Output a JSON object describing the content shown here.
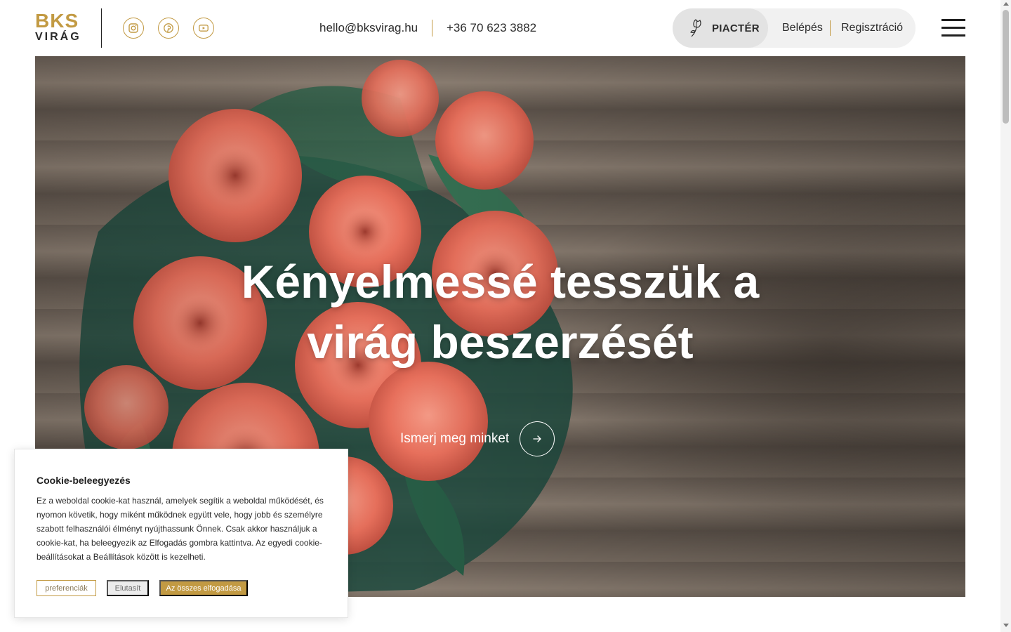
{
  "brand": {
    "line1": "BKS",
    "line2": "VIRÁG",
    "accent_color": "#c29a43",
    "text_color": "#2b2b2b"
  },
  "social": [
    {
      "name": "instagram",
      "icon": "instagram-icon"
    },
    {
      "name": "pinterest",
      "icon": "pinterest-icon"
    },
    {
      "name": "youtube",
      "icon": "youtube-icon"
    }
  ],
  "contact": {
    "email": "hello@bksvirag.hu",
    "phone": "+36 70 623 3882"
  },
  "auth": {
    "market_label": "PIACTÉR",
    "market_icon": "flower-icon",
    "login_label": "Belépés",
    "register_label": "Regisztráció"
  },
  "menu": {
    "icon": "hamburger-menu-icon"
  },
  "hero": {
    "title_line1": "Kényelmessé tesszük a",
    "title_line2": "virág beszerzését",
    "cta_label": "Ismerj meg minket",
    "cta_icon": "arrow-right-icon",
    "image_subject": "rose-bouquet-photo"
  },
  "cookie": {
    "title": "Cookie-beleegyezés",
    "text": "Ez a weboldal cookie-kat használ, amelyek segítik a weboldal működését, és nyomon követik, hogy miként működnek együtt vele, hogy jobb és személyre szabott felhasználói élményt nyújthassunk Önnek. Csak akkor használjuk a cookie-kat, ha beleegyezik az Elfogadás gombra kattintva. Az egyedi cookie-beállításokat a Beállítások között is kezelheti.",
    "btn_preferences": "preferenciák",
    "btn_reject": "Elutasít",
    "btn_accept_all": "Az összes elfogadása"
  }
}
